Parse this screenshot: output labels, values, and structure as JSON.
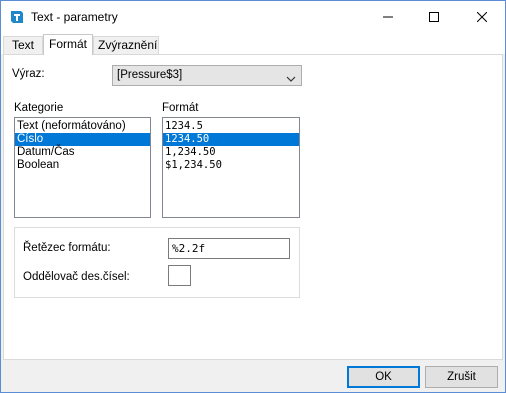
{
  "window": {
    "title": "Text - parametry",
    "accent": "#0078d7"
  },
  "tabs": [
    {
      "label": "Text"
    },
    {
      "label": "Formát"
    },
    {
      "label": "Zvýraznění"
    }
  ],
  "expression": {
    "label": "Výraz:",
    "value": "[Pressure$3]"
  },
  "category": {
    "label": "Kategorie",
    "items": [
      "Text (neformátováno)",
      "Číslo",
      "Datum/Čas",
      "Boolean"
    ],
    "selected": "Číslo"
  },
  "format": {
    "label": "Formát",
    "items": [
      "1234.5",
      "1234.50",
      "1,234.50",
      "$1,234.50"
    ],
    "selected": "1234.50"
  },
  "format_string": {
    "label": "Řetězec formátu:",
    "value": "%2.2f"
  },
  "decimal_separator": {
    "label": "Oddělovač des.čísel:",
    "value": ""
  },
  "buttons": {
    "ok": "OK",
    "cancel": "Zrušit"
  }
}
